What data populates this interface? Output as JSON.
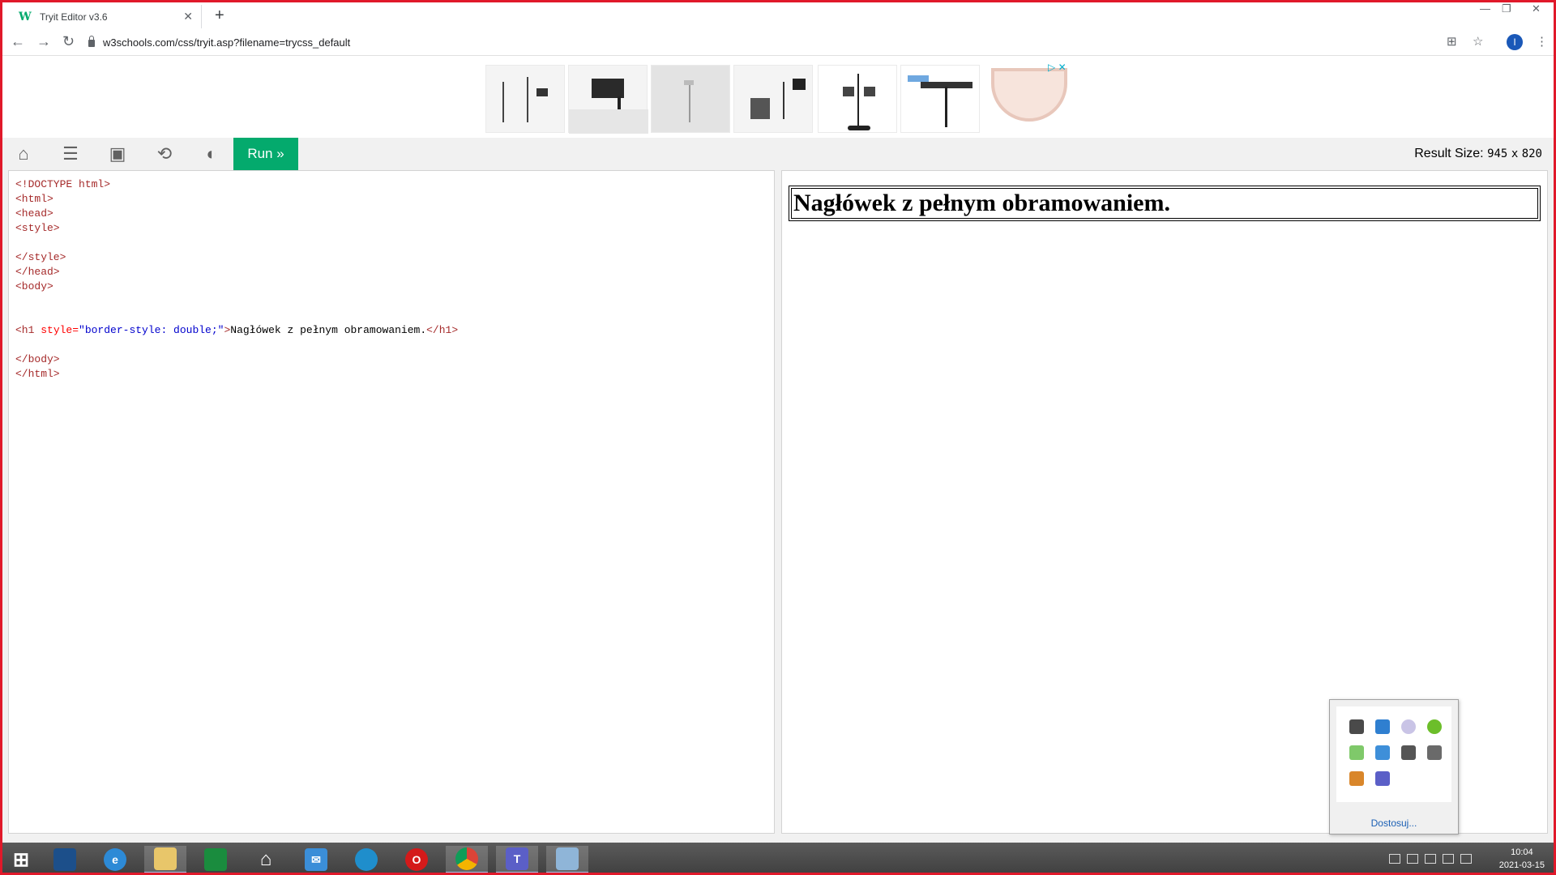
{
  "browser": {
    "tab_title": "Tryit Editor v3.6",
    "tab_favicon": "W",
    "url": "w3schools.com/css/tryit.asp?filename=trycss_default",
    "profile_initial": "I"
  },
  "icons": {
    "back": "back-arrow-icon",
    "forward": "forward-arrow-icon",
    "reload": "reload-icon",
    "translate": "translate-icon",
    "bookmark": "star-icon",
    "menu": "kebab-menu-icon",
    "home": "home-icon",
    "hamburger": "hamburger-menu-icon",
    "save": "save-icon",
    "rotate": "rotate-icon",
    "contrast": "contrast-icon"
  },
  "editor": {
    "run_label": "Run »",
    "result_size_label": "Result Size:",
    "result_width": "945",
    "result_sep": "x",
    "result_height": "820",
    "code": {
      "doctype": "<!DOCTYPE html>",
      "html_open": "<html>",
      "head_open": "<head>",
      "style_open": "<style>",
      "style_close": "</style>",
      "head_close": "</head>",
      "body_open": "<body>",
      "h1_tag": "<h1 ",
      "h1_attr": "style=",
      "h1_attrval": "\"border-style: double;\"",
      "h1_gt": ">",
      "h1_text": "Nagłówek z pełnym obramowaniem.",
      "h1_close": "</h1>",
      "body_close": "</body>",
      "html_close": "</html>"
    },
    "result_heading": "Nagłówek z pełnym obramowaniem."
  },
  "tray_popup": {
    "customize_label": "Dostosuj..."
  },
  "taskbar": {
    "time": "10:04",
    "date": "2021-03-15"
  },
  "colors": {
    "run_green": "#04aa6d",
    "frame_red": "#e0192a"
  }
}
